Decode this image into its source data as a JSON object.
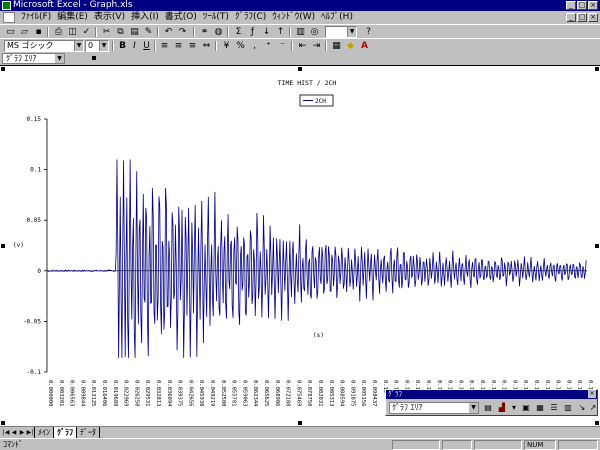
{
  "window": {
    "title": "Microsoft Excel - Graph.xls",
    "buttons": [
      "_",
      "□",
      "×"
    ]
  },
  "menu": {
    "items": [
      "ﾌｧｲﾙ(F)",
      "編集(E)",
      "表示(V)",
      "挿入(I)",
      "書式(O)",
      "ﾂｰﾙ(T)",
      "ｸﾞﾗﾌ(C)",
      "ｳｨﾝﾄﾞｳ(W)",
      "ﾍﾙﾌﾟ(H)"
    ]
  },
  "toolbar": {
    "font_name": "MS ゴシック",
    "font_size": "0",
    "bold": "B",
    "italic": "I",
    "underline": "U",
    "font_color": "A"
  },
  "namebox": {
    "value": "ｸﾞﾗﾌ ｴﾘｱ"
  },
  "chart_data": {
    "type": "line",
    "title": "TIME HIST / 2CH",
    "legend": [
      "2CH"
    ],
    "legend_position": "top-center",
    "ylabel": "(v)",
    "xlabel": "(s)",
    "ylim": [
      -0.1,
      0.15
    ],
    "yticks": [
      "0.15",
      "0.1",
      "0.05",
      "0",
      "-0.05",
      "-0.1"
    ],
    "xticks": [
      "0.000000",
      "0.003281",
      "0.006563",
      "0.009844",
      "0.013125",
      "0.016406",
      "0.019688",
      "0.022969",
      "0.026250",
      "0.029531",
      "0.032813",
      "0.036094",
      "0.039375",
      "0.042656",
      "0.045938",
      "0.049219",
      "0.052500",
      "0.055781",
      "0.059063",
      "0.062344",
      "0.065625",
      "0.068906",
      "0.072188",
      "0.075469",
      "0.078750",
      "0.082031",
      "0.085313",
      "0.088594",
      "0.091875",
      "0.095156",
      "0.098437",
      "0.10",
      "0.10",
      "0.11",
      "0.11",
      "0.11",
      "0.12",
      "0.12",
      "0.12",
      "0.13",
      "0.13",
      "0.13",
      "0.14",
      "0.14",
      "0.14",
      "0.15",
      "0.15",
      "0.15",
      "0.16",
      "0.16",
      "0.16"
    ],
    "series": [
      {
        "name": "2CH",
        "color": "#000080",
        "description_values": {
          "quiet_until_s": 0.021,
          "onset_peak_max": 0.11,
          "onset_peak_min": -0.086,
          "end_amplitude": 0.005
        }
      }
    ],
    "grid": false
  },
  "chart_toolbar": {
    "title": "ｸﾞﾗﾌ",
    "object_select": "ｸﾞﾗﾌ ｴﾘｱ"
  },
  "sheet_tabs": {
    "tabs": [
      "ﾒｲﾝ",
      "ｸﾞﾗﾌ",
      "ﾃﾞｰﾀ"
    ],
    "active": 1
  },
  "status": {
    "text": "ｺﾏﾝﾄﾞ",
    "num": "NUM"
  },
  "colors": {
    "titlebar": "#000080",
    "series": "#000080",
    "window_bg": "#c0c0c0"
  }
}
